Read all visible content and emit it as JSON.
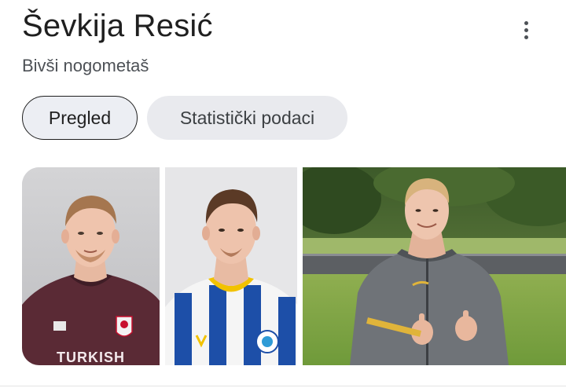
{
  "header": {
    "title": "Ševkija Resić",
    "subtitle": "Bivši nogometaš",
    "more_icon": "more-vert-icon"
  },
  "tabs": [
    {
      "label": "Pregled",
      "selected": true
    },
    {
      "label": "Statistički podaci",
      "selected": false
    }
  ],
  "images": [
    {
      "jersey_text": "TURKISH"
    },
    {
      "jersey_text": ""
    },
    {
      "jersey_text": ""
    }
  ],
  "colors": {
    "title_text": "#1f1f1f",
    "subtitle_text": "#4d5156",
    "chip_selected_bg": "#eceef3",
    "chip_bg": "#e9eaee"
  }
}
